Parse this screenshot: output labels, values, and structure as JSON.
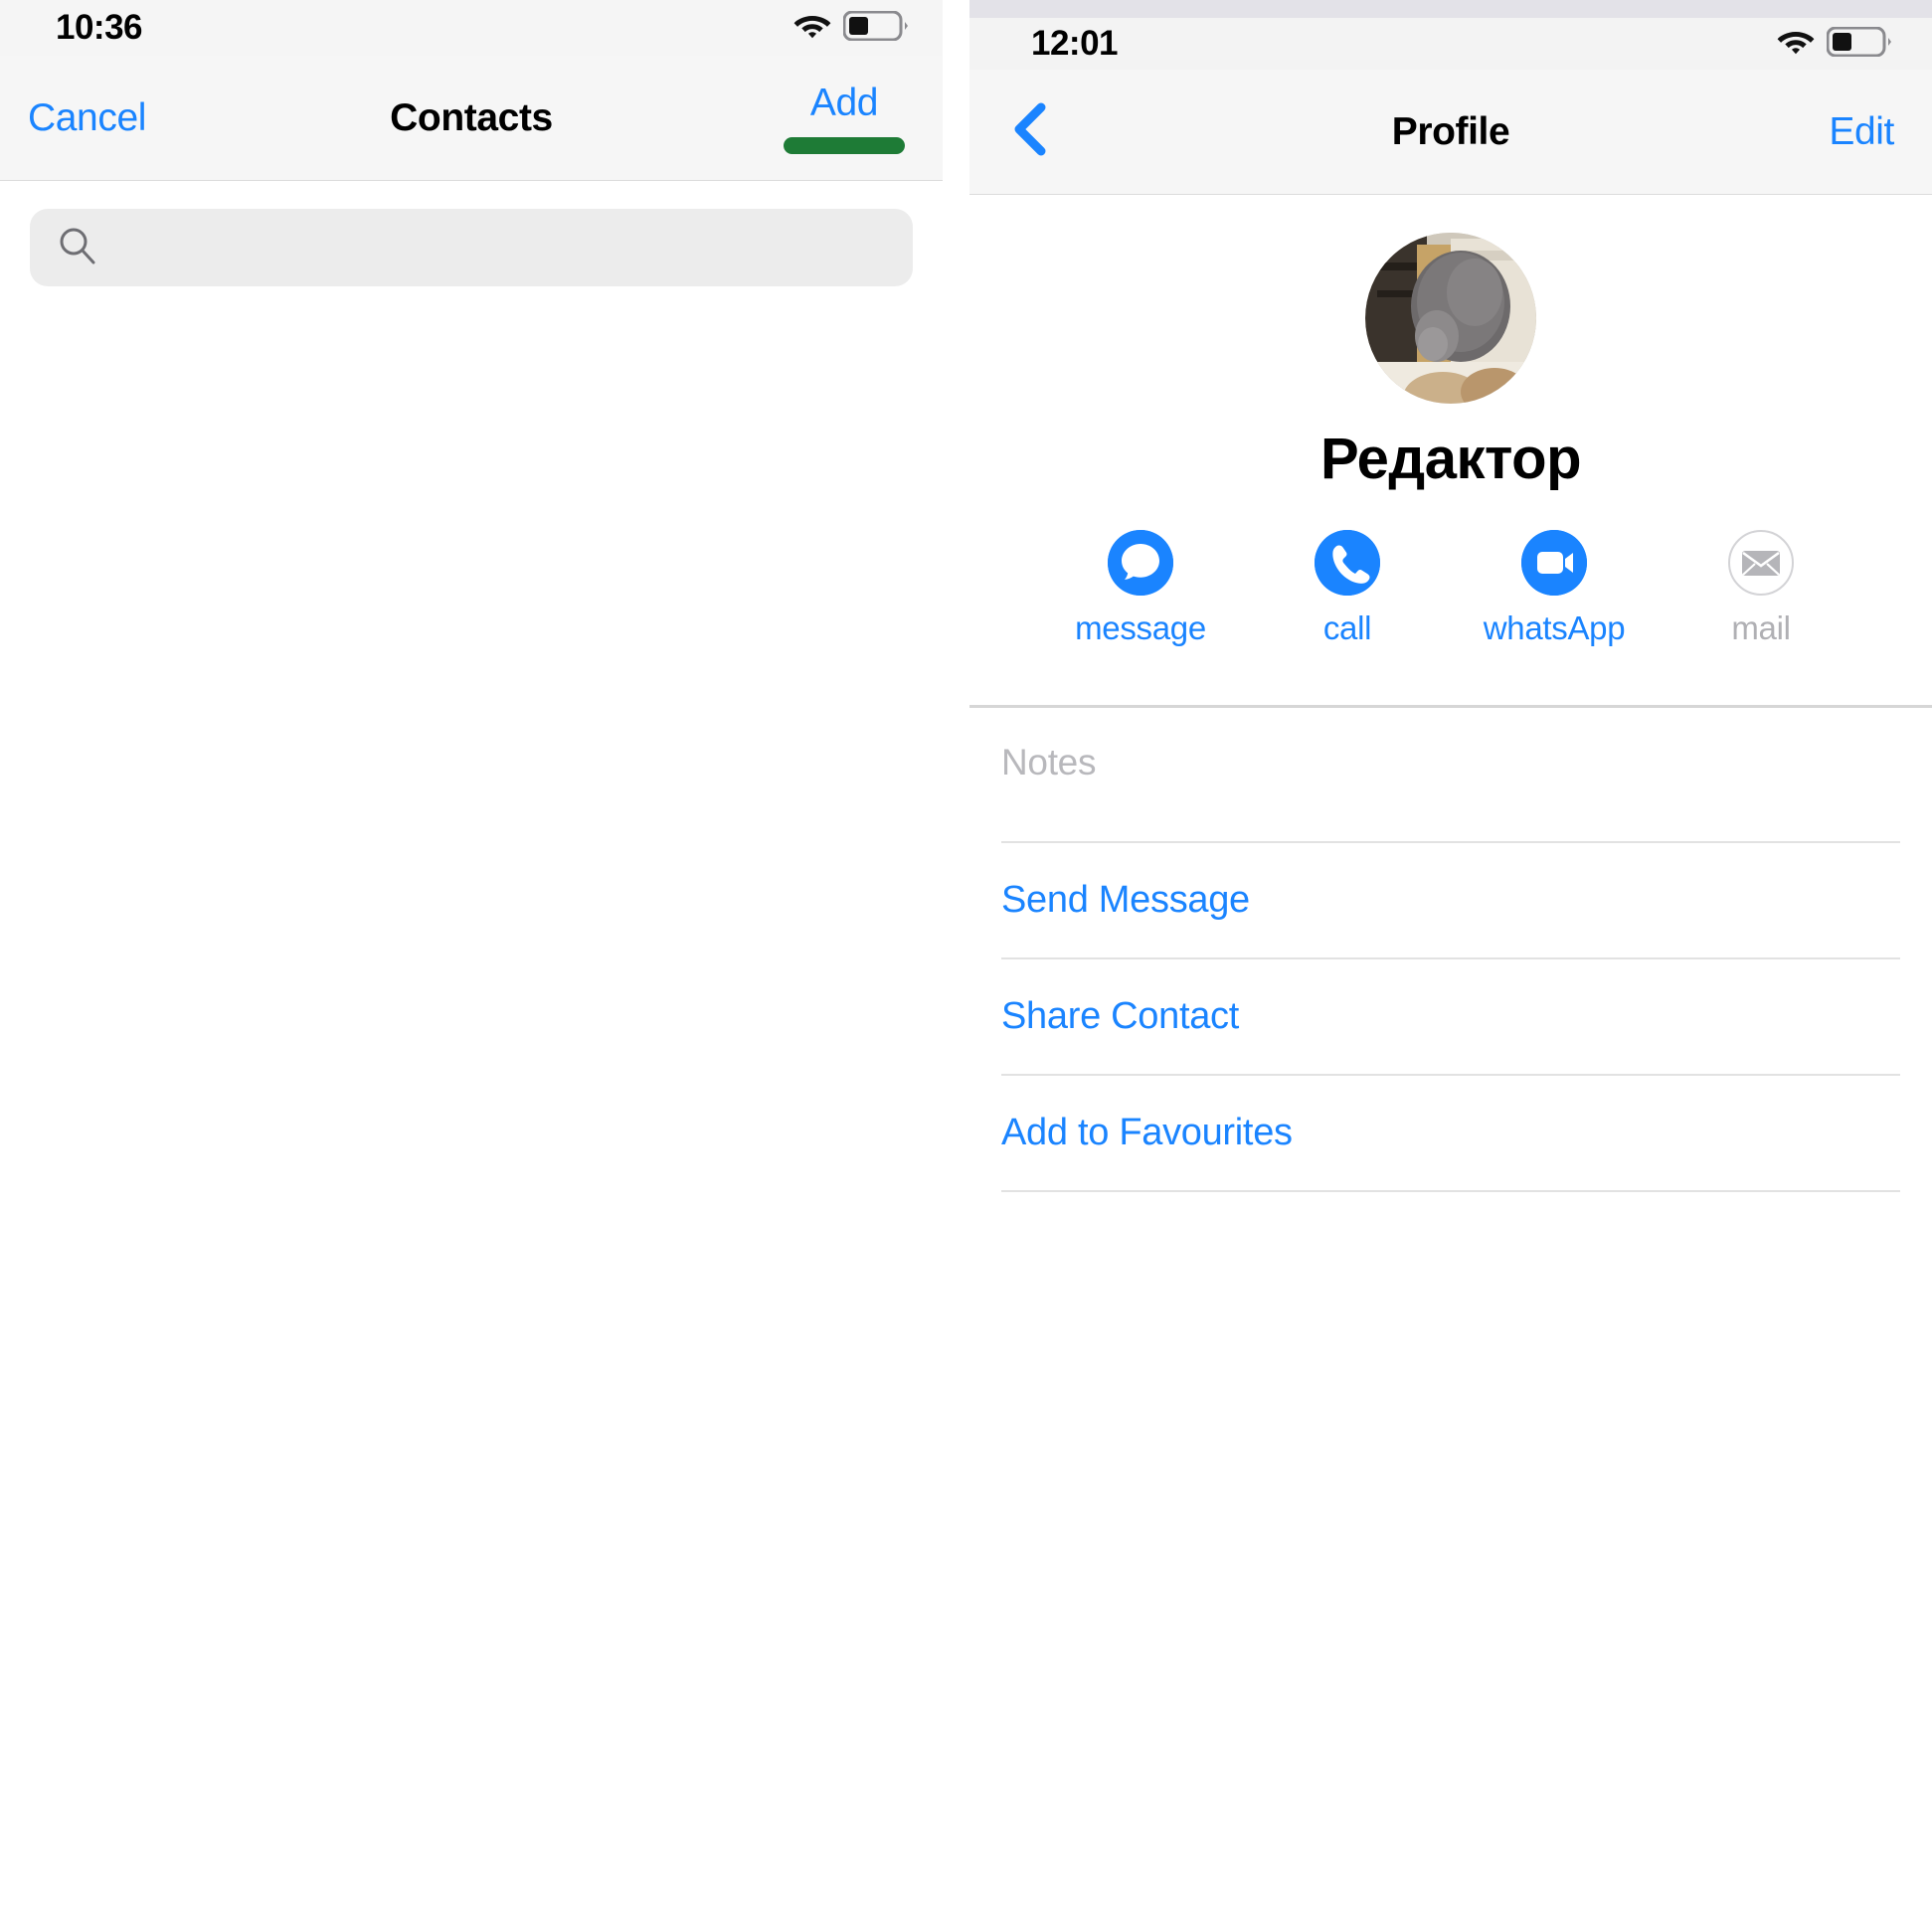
{
  "left_screen": {
    "status_bar": {
      "time": "10:36",
      "wifi_icon": "wifi-icon",
      "battery_icon": "battery-icon",
      "battery_level_percent": 35
    },
    "nav_bar": {
      "cancel_label": "Cancel",
      "title": "Contacts",
      "add_label": "Add",
      "add_highlight_color": "#1e7b36"
    },
    "search": {
      "icon": "search-icon",
      "value": "",
      "placeholder": ""
    },
    "contact_list": {
      "items": []
    }
  },
  "right_screen": {
    "status_bar": {
      "time": "12:01",
      "wifi_icon": "wifi-icon",
      "battery_icon": "battery-icon",
      "battery_level_percent": 35
    },
    "nav_bar": {
      "back_icon": "chevron-left-icon",
      "title": "Profile",
      "edit_label": "Edit"
    },
    "profile": {
      "avatar_icon": "contact-avatar-photo",
      "avatar_description": "grey cat in cardboard box",
      "name": "Редактор"
    },
    "quick_actions": [
      {
        "label": "message",
        "icon": "message-bubble-icon",
        "enabled": true,
        "color": "#1a84ff"
      },
      {
        "label": "call",
        "icon": "phone-icon",
        "enabled": true,
        "color": "#1a84ff"
      },
      {
        "label": "whatsApp",
        "icon": "video-camera-icon",
        "enabled": true,
        "color": "#1a84ff"
      },
      {
        "label": "mail",
        "icon": "envelope-icon",
        "enabled": false,
        "color": "#b0b0b4"
      }
    ],
    "notes": {
      "placeholder": "Notes",
      "value": ""
    },
    "action_rows": [
      {
        "label": "Send Message"
      },
      {
        "label": "Share Contact"
      },
      {
        "label": "Add to Favourites"
      }
    ]
  },
  "theme": {
    "accent_blue": "#1a84ff",
    "highlight_green": "#1e7b36",
    "disabled_grey": "#b0b0b4",
    "divider_grey": "#d6d6d6"
  }
}
